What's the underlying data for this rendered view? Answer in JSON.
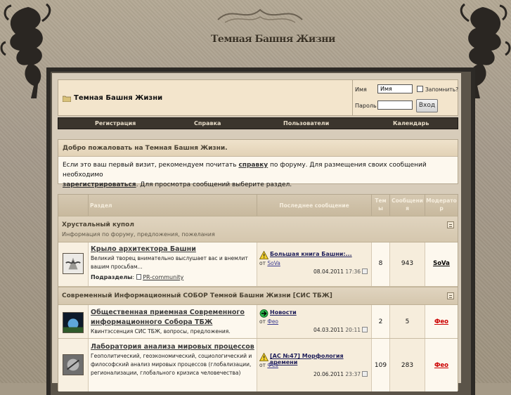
{
  "header": {
    "title": "Темная Башня Жизни"
  },
  "login": {
    "site_name": "Темная Башня Жизни",
    "username_label": "Имя",
    "username_value": "Имя",
    "password_label": "Пароль",
    "remember_label": "Запомнить?",
    "login_button": "Вход"
  },
  "nav": {
    "items": [
      "Регистрация",
      "Справка",
      "Пользователи",
      "Календарь"
    ]
  },
  "welcome": {
    "title": "Добро пожаловать на Темная Башня Жизни.",
    "text1": "Если это ваш первый визит, рекомендуем почитать ",
    "link1": "справку",
    "text2": " по форуму. Для размещения своих сообщений необходимо",
    "link2": "зарегистрироваться",
    "text3": ". Для просмотра сообщений выберите раздел."
  },
  "table": {
    "headers": {
      "section": "Раздел",
      "last_post": "Последнее сообщение",
      "topics": "Тем ы",
      "posts": "Сообщени я",
      "moderator": "Модерато р"
    }
  },
  "categories": [
    {
      "title": "Хрустальный купол",
      "subtitle": "Информация по форуму, предложения, пожелания"
    },
    {
      "title": "Современный Информационный СОБОР Темной Башни Жизни [СИС ТБЖ]",
      "subtitle": ""
    }
  ],
  "forums": [
    {
      "title": "Крыло архитектора Башни",
      "desc": "Великий творец внимательно выслушает вас и внемлит вашим просьбам...",
      "subforums_label": "Подразделы",
      "subforum": "PR-community",
      "last_title": "Большая книга Башни:...",
      "last_by_label": "от",
      "last_by": "SoVa",
      "last_date": "08.04.2011",
      "last_time": "17:36",
      "topics": "8",
      "posts": "943",
      "moderator": "SoVa",
      "moderator_color": "#000000"
    },
    {
      "title": "Общественная приемная Современного информационного Собора ТБЖ",
      "desc": "Квинтэссенция СИС ТБЖ, вопросы, предложения.",
      "last_title": "Новости",
      "last_by_label": "от",
      "last_by": "Фео",
      "last_date": "04.03.2011",
      "last_time": "20:11",
      "topics": "2",
      "posts": "5",
      "moderator": "Фео",
      "moderator_color": "#cc0000"
    },
    {
      "title": "Лаборатория анализа мировых процессов",
      "desc": "Геополитический, геоэкономический, социологический и философский анализ мировых процессов (глобализации, регионализации, глобального кризиса человечества)",
      "last_title": "[АС №47] Морфология времени",
      "last_by_label": "от",
      "last_by": "Фео",
      "last_date": "20.06.2011",
      "last_time": "23:37",
      "topics": "109",
      "posts": "283",
      "moderator": "Фео",
      "moderator_color": "#cc0000"
    }
  ],
  "colors": {
    "frame": "#2d2a26",
    "navbar": "#3b352d",
    "background": "#a59a87"
  }
}
